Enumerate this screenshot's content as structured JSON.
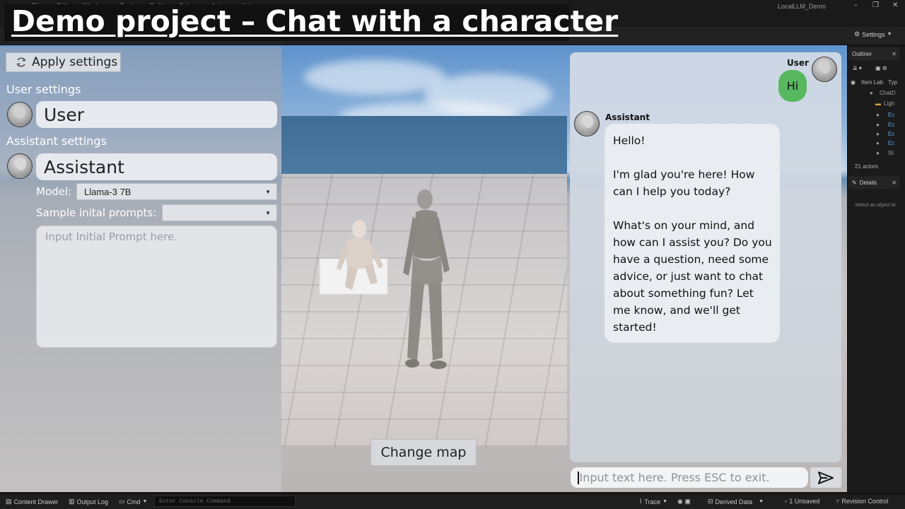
{
  "banner": {
    "title": "Demo project – Chat with a character"
  },
  "editor": {
    "window_title": "LocalLLM_Demo",
    "menu": [
      "File",
      "Edit",
      "Window",
      "Tools",
      "Build",
      "Select",
      "Actor",
      "Help"
    ],
    "settings_label": "Settings"
  },
  "left_panel": {
    "apply_button": "Apply settings",
    "user_section": "User settings",
    "user_name": "User",
    "assistant_section": "Assistant settings",
    "assistant_name": "Assistant",
    "model_label": "Model:",
    "model_value": "Llama-3 7B",
    "sample_prompts_label": "Sample inital prompts:",
    "sample_prompts_value": "",
    "prompt_placeholder": "Input Initial Prompt here."
  },
  "viewport": {
    "change_map_button": "Change map"
  },
  "chat": {
    "user_name": "User",
    "user_message": "Hi",
    "assistant_name": "Assistant",
    "assistant_paragraphs": [
      "Hello!",
      "I'm glad you're here! How can I help you today?",
      "What's on your mind, and how can I assist you? Do you have a question, need some advice, or just want to chat about something fun? Let me know, and we'll get started!"
    ],
    "input_placeholder": "Input text here. Press ESC to exit."
  },
  "outliner": {
    "tab": "Outliner",
    "column_label": "Item Lab",
    "column_type": "Typ",
    "rows": [
      "ChatD",
      "Ligh",
      "Ec",
      "Ec",
      "Ec",
      "Ec",
      "St"
    ],
    "actor_count": "21 actors"
  },
  "details": {
    "tab": "Details",
    "empty_text": "Select an object to"
  },
  "statusbar": {
    "content_drawer": "Content Drawer",
    "output_log": "Output Log",
    "cmd": "Cmd",
    "console_placeholder": "Enter Console Command",
    "trace": "Trace",
    "derived_data": "Derived Data",
    "unsaved": "1 Unsaved",
    "revision_control": "Revision Control"
  },
  "colors": {
    "user_bubble": "#57b85f",
    "assistant_bubble": "#e9ecf1",
    "banner_bg": "#111111"
  }
}
